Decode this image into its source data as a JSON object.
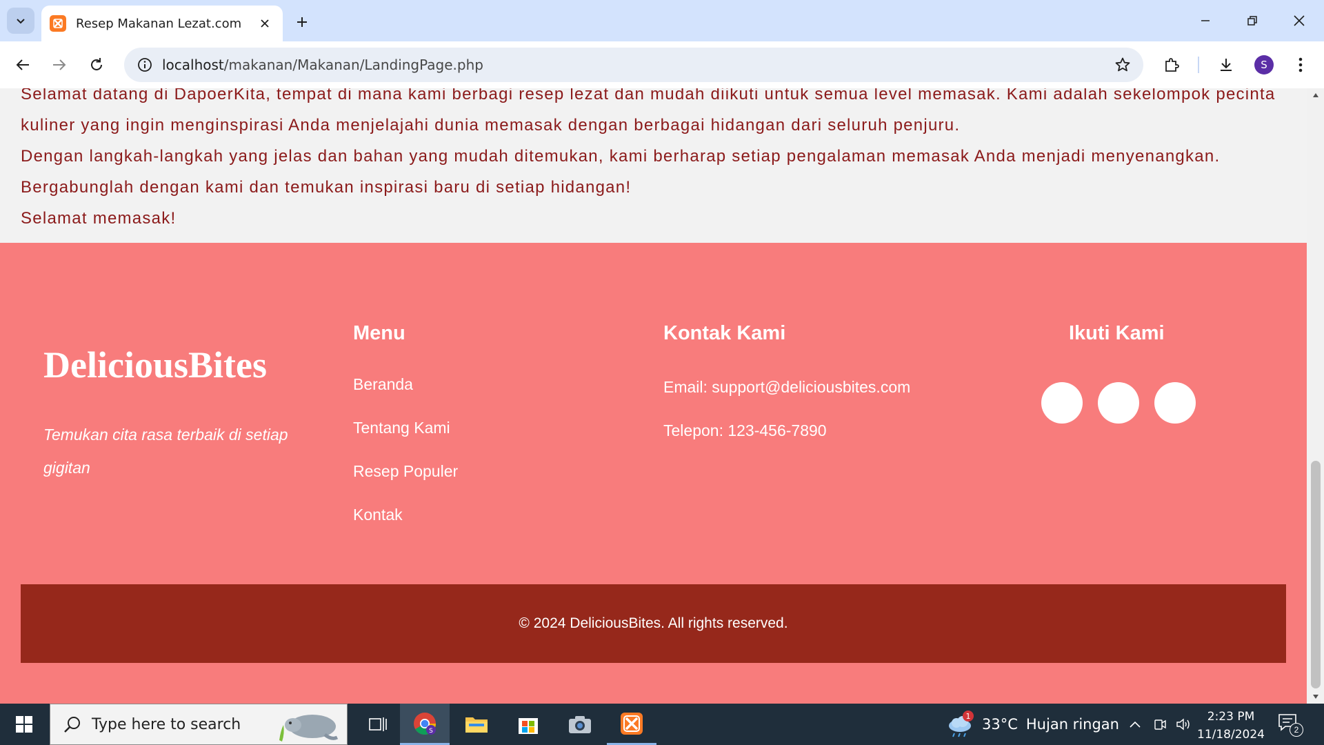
{
  "browser": {
    "tab_title": "Resep Makanan Lezat.com",
    "url_host": "localhost",
    "url_path": "/makanan/Makanan/LandingPage.php",
    "profile_initial": "S"
  },
  "page": {
    "intro_lines": [
      "Selamat datang di DapoerKita, tempat di mana kami berbagi resep lezat dan mudah diikuti untuk semua level memasak. Kami adalah sekelompok pecinta",
      "kuliner yang ingin menginspirasi Anda menjelajahi dunia memasak dengan berbagai hidangan dari seluruh penjuru.",
      "Dengan langkah-langkah yang jelas dan bahan yang mudah ditemukan, kami berharap setiap pengalaman memasak Anda menjadi menyenangkan.",
      "Bergabunglah dengan kami dan temukan inspirasi baru di setiap hidangan!",
      "Selamat memasak!"
    ],
    "footer": {
      "brand": "DeliciousBites",
      "tagline": "Temukan cita rasa terbaik di setiap gigitan",
      "menu_heading": "Menu",
      "menu_items": [
        "Beranda",
        "Tentang Kami",
        "Resep Populer",
        "Kontak"
      ],
      "contact_heading": "Kontak Kami",
      "email": "Email: support@deliciousbites.com",
      "phone": "Telepon: 123-456-7890",
      "follow_heading": "Ikuti Kami",
      "copyright": "© 2024 DeliciousBites. All rights reserved."
    }
  },
  "taskbar": {
    "search_placeholder": "Type here to search",
    "weather_badge": "1",
    "weather_temp": "33°C",
    "weather_desc": "Hujan ringan",
    "time": "2:23 PM",
    "date": "11/18/2024",
    "notification_count": "2"
  },
  "colors": {
    "footer_bg": "#f87c7c",
    "copyright_bg": "#96281b",
    "intro_text": "#8b1a1a"
  }
}
